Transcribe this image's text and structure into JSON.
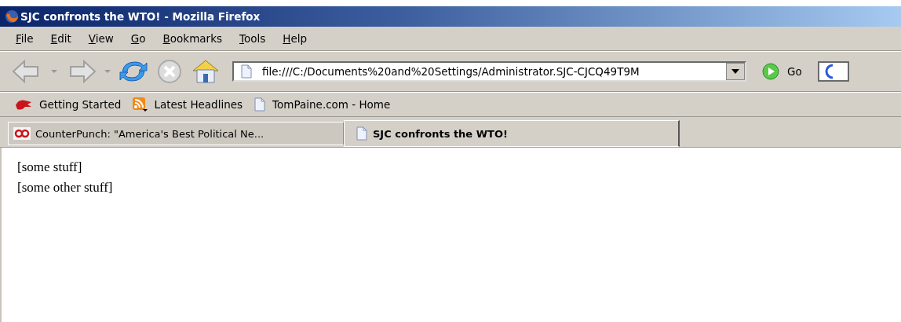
{
  "window": {
    "title": "SJC confronts the WTO! - Mozilla Firefox"
  },
  "menu": [
    "File",
    "Edit",
    "View",
    "Go",
    "Bookmarks",
    "Tools",
    "Help"
  ],
  "toolbar": {
    "address": "file:///C:/Documents%20and%20Settings/Administrator.SJC-CJCQ49T9M",
    "go_label": "Go"
  },
  "bookmarks": [
    {
      "kind": "firefox",
      "label": "Getting Started"
    },
    {
      "kind": "feed",
      "label": "Latest Headlines"
    },
    {
      "kind": "page",
      "label": "TomPaine.com - Home"
    }
  ],
  "tabs": [
    {
      "kind": "cp",
      "label": "CounterPunch: \"America's Best Political Ne...",
      "selected": false
    },
    {
      "kind": "page",
      "label": "SJC confronts the WTO!",
      "selected": true
    }
  ],
  "content": [
    "[some stuff]",
    "[some other stuff]"
  ]
}
